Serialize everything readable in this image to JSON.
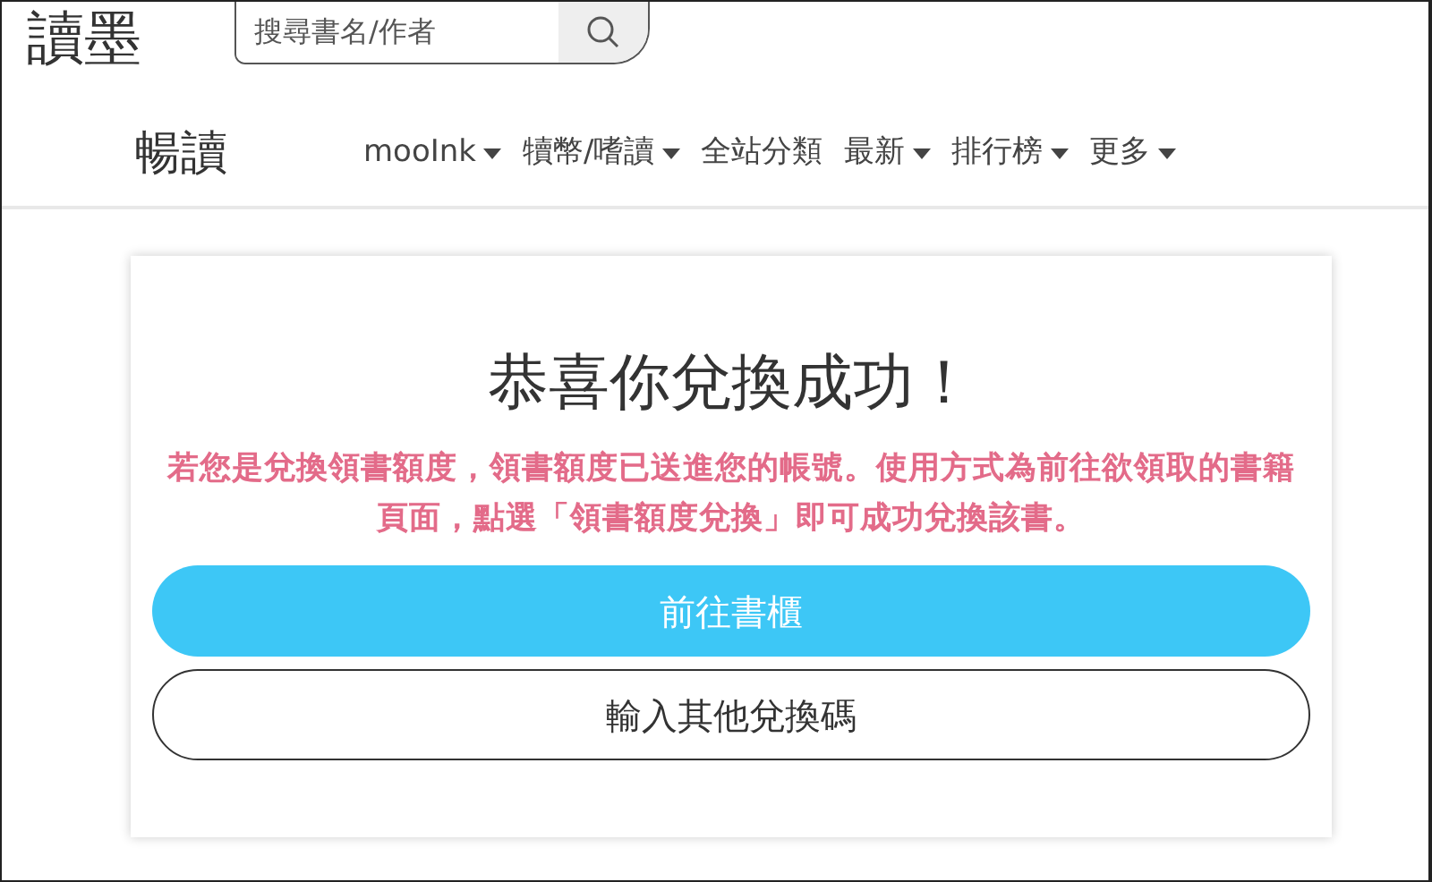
{
  "header": {
    "logo": "讀墨",
    "search": {
      "placeholder": "搜尋書名/作者"
    }
  },
  "nav": {
    "brand": "暢讀",
    "items": [
      {
        "label": "mooInk",
        "dropdown": true
      },
      {
        "label": "犢幣/嗜讀",
        "dropdown": true
      },
      {
        "label": "全站分類",
        "dropdown": false
      },
      {
        "label": "最新",
        "dropdown": true
      },
      {
        "label": "排行榜",
        "dropdown": true
      },
      {
        "label": "更多",
        "dropdown": true
      }
    ]
  },
  "card": {
    "title": "恭喜你兌換成功！",
    "message": "若您是兌換領書額度，領書額度已送進您的帳號。使用方式為前往欲領取的書籍頁面，點選「領書額度兌換」即可成功兌換該書。",
    "buttons": [
      {
        "label": "前往書櫃",
        "kind": "primary"
      },
      {
        "label": "輸入其他兌換碼",
        "kind": "outline"
      }
    ]
  }
}
